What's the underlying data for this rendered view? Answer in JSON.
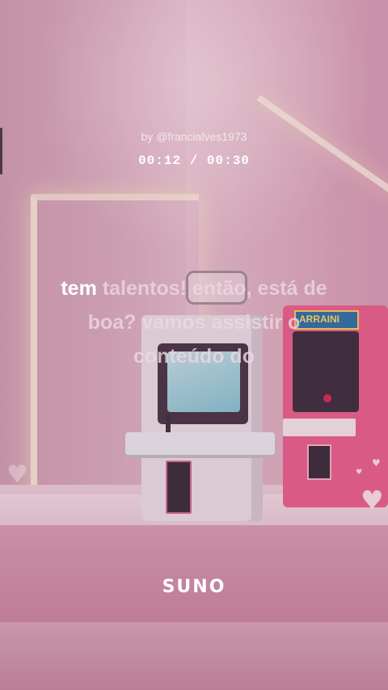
{
  "player": {
    "author": "by @francialves1973",
    "time": "00:12 / 00:30"
  },
  "lyrics": {
    "active_word": "tem",
    "line1_rest": "talentos! então, está de",
    "line2": "boa? vamos assistir o",
    "line3": "conteúdo do"
  },
  "scene": {
    "arcade_marquee": "ARRAINI"
  },
  "brand": {
    "logo_text": "SUNO"
  },
  "colors": {
    "active_lyric": "#ffffff",
    "inactive_lyric": "#ebd7e1",
    "background_tint": "#d9a9bd"
  }
}
